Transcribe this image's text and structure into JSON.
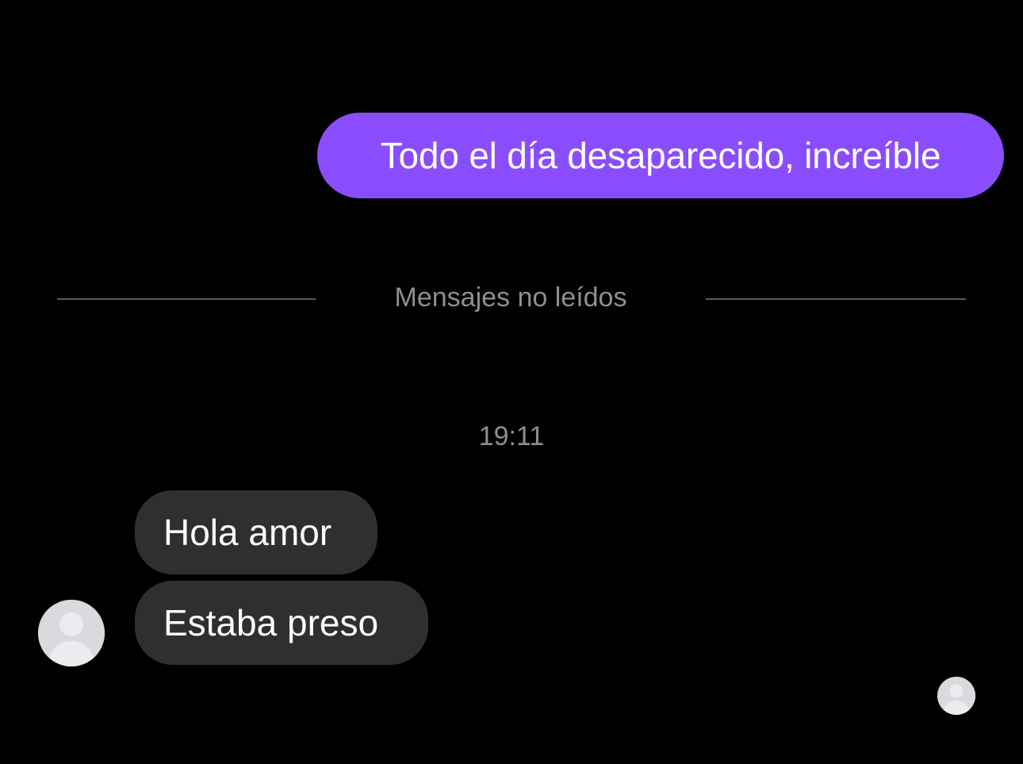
{
  "colors": {
    "background": "#000000",
    "sent_bubble": "#8a4dfd",
    "received_bubble": "#2f2f31",
    "muted_text": "#8e8e93"
  },
  "messages": {
    "sent": [
      {
        "text": "Todo el día desaparecido, increíble"
      }
    ],
    "received": [
      {
        "text": "Hola amor"
      },
      {
        "text": "Estaba preso"
      }
    ]
  },
  "divider": {
    "label": "Mensajes no leídos"
  },
  "timestamp": "19:11",
  "avatars": {
    "sender_icon": "default-user-avatar-icon",
    "seen_icon": "read-receipt-avatar-icon"
  }
}
